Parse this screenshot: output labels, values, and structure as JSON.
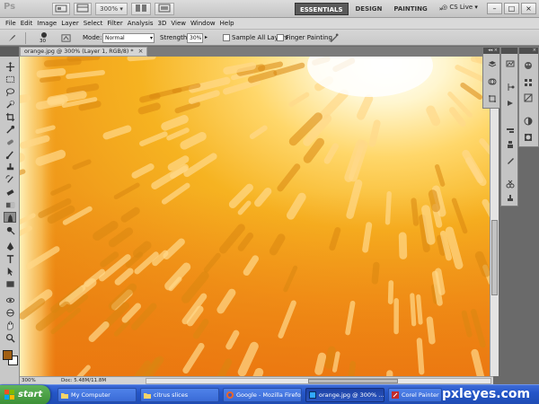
{
  "app": {
    "logo_text": "Ps",
    "zoom_select": "300%",
    "workspaces": [
      "ESSENTIALS",
      "DESIGN",
      "PAINTING"
    ],
    "workspace_more": "»",
    "cs_live": "CS Live",
    "window_controls": [
      "–",
      "□",
      "×"
    ]
  },
  "menu": [
    "File",
    "Edit",
    "Image",
    "Layer",
    "Select",
    "Filter",
    "Analysis",
    "3D",
    "View",
    "Window",
    "Help"
  ],
  "options": {
    "brush_size": "30",
    "mode_label": "Mode:",
    "mode_value": "Normal",
    "strength_label": "Strength:",
    "strength_value": "30%",
    "sample_all_layers_label": "Sample All Layers",
    "sample_all_layers_checked": false,
    "finger_painting_label": "Finger Painting",
    "finger_painting_checked": false
  },
  "document": {
    "tab_title": "orange.jpg @ 300% (Layer 1, RGB/8) *",
    "tab_close": "×",
    "zoom": "300%",
    "doc_size": "Doc: 5.48M/11.8M",
    "foreground_color": "#a15f12",
    "background_color": "#ffffff"
  },
  "tools": [
    "move-tool-icon",
    "marquee-tool-icon",
    "lasso-tool-icon",
    "quick-selection-tool-icon",
    "crop-tool-icon",
    "eyedropper-tool-icon",
    "spot-healing-tool-icon",
    "brush-tool-icon",
    "clone-stamp-tool-icon",
    "history-brush-tool-icon",
    "eraser-tool-icon",
    "gradient-tool-icon",
    "smudge-tool-icon",
    "dodge-tool-icon",
    "pen-tool-icon",
    "type-tool-icon",
    "path-selection-tool-icon",
    "rectangle-tool-icon",
    "3d-rotate-tool-icon",
    "3d-orbit-tool-icon",
    "hand-tool-icon",
    "zoom-tool-icon"
  ],
  "active_tool": "smudge-tool-icon",
  "taskbar": {
    "start_label": "start",
    "items": [
      {
        "label": "My Computer",
        "icon": "folder-icon",
        "active": false
      },
      {
        "label": "citrus slices",
        "icon": "folder-icon",
        "active": false
      },
      {
        "label": "Google - Mozilla Firefox",
        "icon": "firefox-icon",
        "active": false
      },
      {
        "label": "orange.jpg @ 300% ...",
        "icon": "photoshop-icon",
        "active": true
      },
      {
        "label": "Corel Painter",
        "icon": "painter-icon",
        "active": false
      }
    ]
  },
  "watermark": "pxleyes.com"
}
